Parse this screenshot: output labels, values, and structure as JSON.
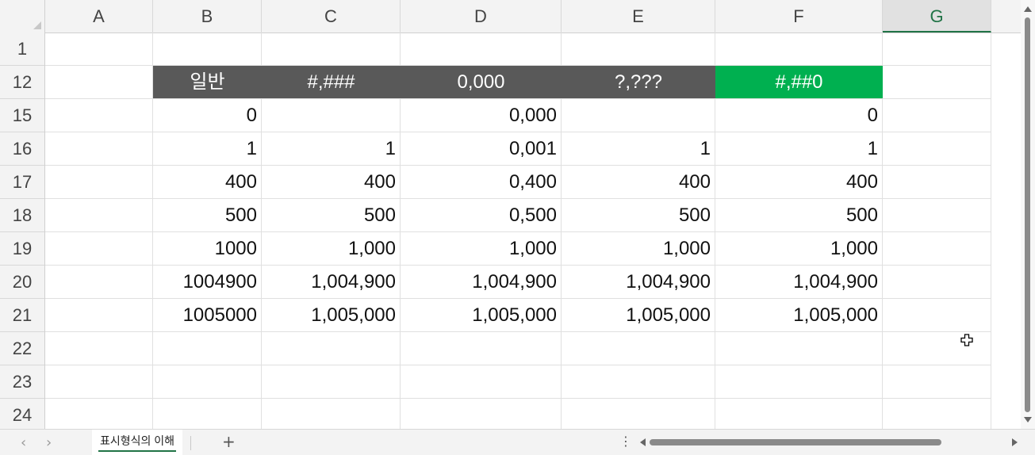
{
  "columns": [
    {
      "label": "A",
      "selected": false
    },
    {
      "label": "B",
      "selected": false
    },
    {
      "label": "C",
      "selected": false
    },
    {
      "label": "D",
      "selected": false
    },
    {
      "label": "E",
      "selected": false
    },
    {
      "label": "F",
      "selected": false
    },
    {
      "label": "G",
      "selected": true
    }
  ],
  "rows": [
    {
      "label": "1",
      "cells": [
        "",
        "",
        "",
        "",
        "",
        "",
        ""
      ]
    },
    {
      "label": "12",
      "cells": [
        "",
        "일반",
        "#,###",
        "0,000",
        "?,???",
        "#,##0",
        ""
      ]
    },
    {
      "label": "15",
      "cells": [
        "",
        "0",
        "",
        "0,000",
        "",
        "0",
        ""
      ]
    },
    {
      "label": "16",
      "cells": [
        "",
        "1",
        "1",
        "0,001",
        "1",
        "1",
        ""
      ]
    },
    {
      "label": "17",
      "cells": [
        "",
        "400",
        "400",
        "0,400",
        "400",
        "400",
        ""
      ]
    },
    {
      "label": "18",
      "cells": [
        "",
        "500",
        "500",
        "0,500",
        "500",
        "500",
        ""
      ]
    },
    {
      "label": "19",
      "cells": [
        "",
        "1000",
        "1,000",
        "1,000",
        "1,000",
        "1,000",
        ""
      ]
    },
    {
      "label": "20",
      "cells": [
        "",
        "1004900",
        "1,004,900",
        "1,004,900",
        "1,004,900",
        "1,004,900",
        ""
      ]
    },
    {
      "label": "21",
      "cells": [
        "",
        "1005000",
        "1,005,000",
        "1,005,000",
        "1,005,000",
        "1,005,000",
        ""
      ]
    },
    {
      "label": "22",
      "cells": [
        "",
        "",
        "",
        "",
        "",
        "",
        ""
      ]
    },
    {
      "label": "23",
      "cells": [
        "",
        "",
        "",
        "",
        "",
        "",
        ""
      ]
    },
    {
      "label": "24",
      "cells": [
        "",
        "",
        "",
        "",
        "",
        "",
        ""
      ]
    }
  ],
  "header_row_label": "12",
  "colors": {
    "header_fill": "#595959",
    "header_highlight_fill": "#00b050",
    "selected_accent": "#217346"
  },
  "sheet_tabs": [
    {
      "label": "표시형식의 이해",
      "active": true
    }
  ],
  "bottom_bar": {
    "prev_label": "‹",
    "next_label": "›",
    "add_sheet_label": "+",
    "more_label": "⋮"
  },
  "icons": {
    "cursor": "cross-cursor-icon"
  }
}
